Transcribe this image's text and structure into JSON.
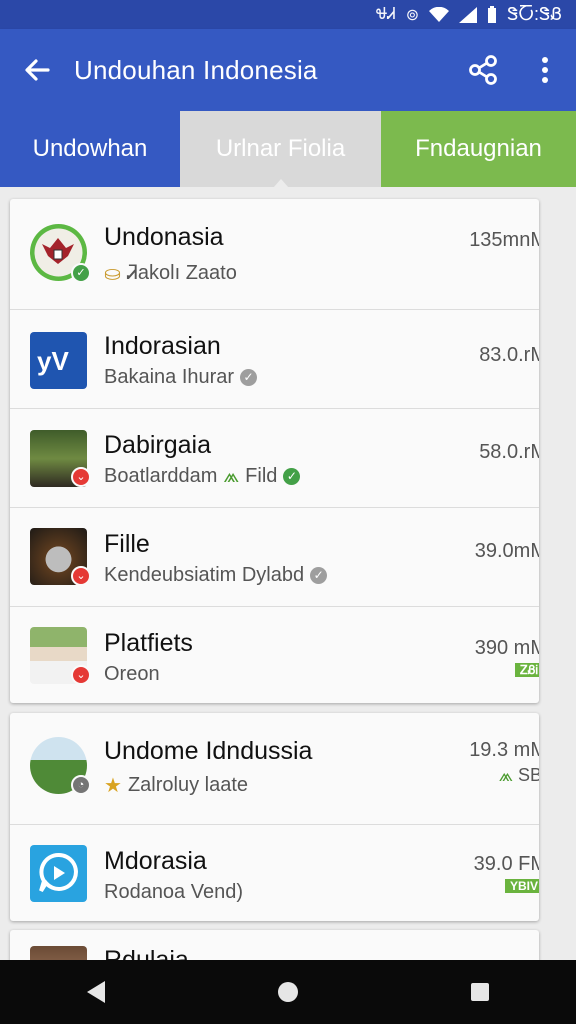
{
  "status_bar": {
    "time": "ᏕႠ:ᏕᏰ"
  },
  "app_bar": {
    "title": "Undouhan Indonesia",
    "icons": [
      "back-arrow-icon",
      "share-icon",
      "more-vertical-icon"
    ]
  },
  "tabs": [
    {
      "label": "Undowhan"
    },
    {
      "label": "Urlnar Fiolia"
    },
    {
      "label": "Fndaugnian"
    }
  ],
  "colors": {
    "primary": "#3559c2",
    "status_bar": "#2b48a8",
    "accent_green": "#7cba4e",
    "badge_red": "#e53935"
  },
  "list_card_1": [
    {
      "name": "Undonasia",
      "subtitle": "Ꮨakolı Zaato",
      "size": "135mnM",
      "thumb_icon": "garuda-emblem-icon"
    },
    {
      "name": "Indorasian",
      "subtitle": "Bakaina Ihurar",
      "size": "83.0.rM",
      "thumb_icon": "yv-logo-icon"
    },
    {
      "name": "Dabirgaia",
      "subtitle": "Boatlarddam",
      "subtitle_extra": "Fild",
      "size": "58.0.rM",
      "thumb_icon": "photo-thumbnail-icon"
    },
    {
      "name": "Fille",
      "subtitle": "Kendeubsiatim Dylabd",
      "size": "39.0mM",
      "thumb_icon": "wolf-thumbnail-icon"
    },
    {
      "name": "Platfiets",
      "subtitle": "Oreon",
      "size": "390 mM",
      "chip": "ᏃᏰᎥ",
      "thumb_icon": "person-photo-icon"
    }
  ],
  "list_card_2": [
    {
      "name": "Undome Idndussia",
      "subtitle": "Zalroluy laate",
      "size": "19.3 mM",
      "size_extra": "SBI",
      "thumb_icon": "field-photo-icon"
    },
    {
      "name": "Mdorasia",
      "subtitle": "Rodanoa Vend)",
      "size": "39.0 FM",
      "chip": "YBIV",
      "thumb_icon": "chat-bubble-icon"
    }
  ],
  "list_card_3": [
    {
      "name": "Rdulaia"
    }
  ]
}
